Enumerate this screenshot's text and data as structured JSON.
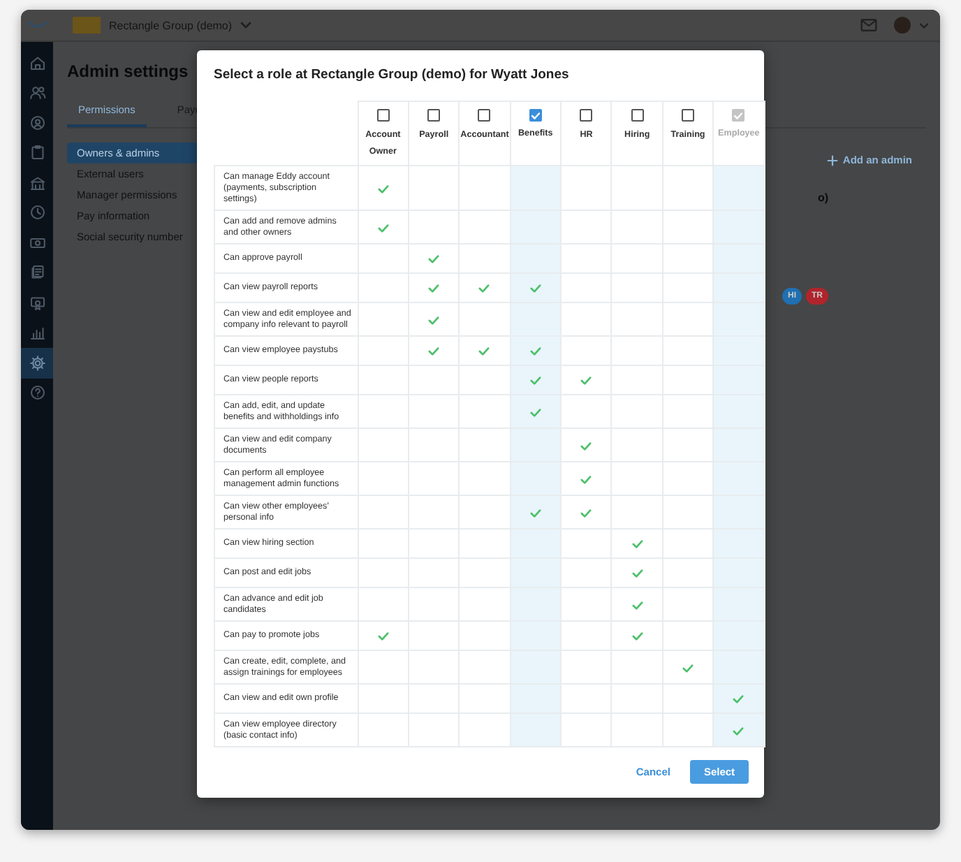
{
  "topbar": {
    "company": "Rectangle Group (demo)"
  },
  "sidebar": {
    "items": [
      {
        "kind": "home",
        "selected": false
      },
      {
        "kind": "people",
        "selected": false
      },
      {
        "kind": "person",
        "selected": false
      },
      {
        "kind": "clipboard",
        "selected": false
      },
      {
        "kind": "building",
        "selected": false
      },
      {
        "kind": "clock",
        "selected": false
      },
      {
        "kind": "money",
        "selected": false
      },
      {
        "kind": "documents",
        "selected": false
      },
      {
        "kind": "certificate",
        "selected": false
      },
      {
        "kind": "chart",
        "selected": false
      },
      {
        "kind": "gear",
        "selected": true
      },
      {
        "kind": "help",
        "selected": false
      }
    ]
  },
  "page": {
    "title": "Admin settings",
    "tabs": [
      {
        "label": "Permissions",
        "selected": true
      },
      {
        "label": "Payr",
        "selected": false
      }
    ],
    "nav": [
      {
        "label": "Owners & admins",
        "selected": true
      },
      {
        "label": "External users",
        "selected": false
      },
      {
        "label": "Manager permissions",
        "selected": false
      },
      {
        "label": "Pay information",
        "selected": false
      },
      {
        "label": "Social security number",
        "selected": false
      }
    ],
    "add_button": "Add an admin",
    "card_fragment": "o)",
    "badges": [
      {
        "label": "HI",
        "color": "#1f6fb2"
      },
      {
        "label": "TR",
        "color": "#b0242c"
      }
    ]
  },
  "dialog": {
    "title": "Select a role at Rectangle Group (demo) for Wyatt Jones",
    "columns": [
      {
        "label": "Account Owner",
        "checked": false,
        "disabled": false
      },
      {
        "label": "Payroll",
        "checked": false,
        "disabled": false
      },
      {
        "label": "Accountant",
        "checked": false,
        "disabled": false
      },
      {
        "label": "Benefits",
        "checked": true,
        "disabled": false
      },
      {
        "label": "HR",
        "checked": false,
        "disabled": false
      },
      {
        "label": "Hiring",
        "checked": false,
        "disabled": false
      },
      {
        "label": "Training",
        "checked": false,
        "disabled": false
      },
      {
        "label": "Employee",
        "checked": true,
        "disabled": true
      }
    ],
    "rows": [
      {
        "label": "Can manage Eddy account (payments, subscription settings)",
        "grants": [
          true,
          false,
          false,
          false,
          false,
          false,
          false,
          false
        ]
      },
      {
        "label": "Can add and remove admins and other owners",
        "grants": [
          true,
          false,
          false,
          false,
          false,
          false,
          false,
          false
        ]
      },
      {
        "label": "Can approve payroll",
        "grants": [
          false,
          true,
          false,
          false,
          false,
          false,
          false,
          false
        ]
      },
      {
        "label": "Can view payroll reports",
        "grants": [
          false,
          true,
          true,
          true,
          false,
          false,
          false,
          false
        ]
      },
      {
        "label": "Can view and edit employee and company info relevant to payroll",
        "grants": [
          false,
          true,
          false,
          false,
          false,
          false,
          false,
          false
        ]
      },
      {
        "label": "Can view employee paystubs",
        "grants": [
          false,
          true,
          true,
          true,
          false,
          false,
          false,
          false
        ]
      },
      {
        "label": "Can view people reports",
        "grants": [
          false,
          false,
          false,
          true,
          true,
          false,
          false,
          false
        ]
      },
      {
        "label": "Can add, edit, and update benefits and withholdings info",
        "grants": [
          false,
          false,
          false,
          true,
          false,
          false,
          false,
          false
        ]
      },
      {
        "label": "Can view and edit company documents",
        "grants": [
          false,
          false,
          false,
          false,
          true,
          false,
          false,
          false
        ]
      },
      {
        "label": "Can perform all employee management admin functions",
        "grants": [
          false,
          false,
          false,
          false,
          true,
          false,
          false,
          false
        ]
      },
      {
        "label": "Can view other employees' personal info",
        "grants": [
          false,
          false,
          false,
          true,
          true,
          false,
          false,
          false
        ]
      },
      {
        "label": "Can view hiring section",
        "grants": [
          false,
          false,
          false,
          false,
          false,
          true,
          false,
          false
        ]
      },
      {
        "label": "Can post and edit jobs",
        "grants": [
          false,
          false,
          false,
          false,
          false,
          true,
          false,
          false
        ]
      },
      {
        "label": "Can advance and edit job candidates",
        "grants": [
          false,
          false,
          false,
          false,
          false,
          true,
          false,
          false
        ]
      },
      {
        "label": "Can pay to promote jobs",
        "grants": [
          true,
          false,
          false,
          false,
          false,
          true,
          false,
          false
        ]
      },
      {
        "label": "Can create, edit, complete, and assign trainings for employees",
        "grants": [
          false,
          false,
          false,
          false,
          false,
          false,
          true,
          false
        ]
      },
      {
        "label": "Can view and edit own profile",
        "grants": [
          false,
          false,
          false,
          false,
          false,
          false,
          false,
          true
        ]
      },
      {
        "label": "Can view employee directory (basic contact info)",
        "grants": [
          false,
          false,
          false,
          false,
          false,
          false,
          false,
          true
        ]
      }
    ],
    "cancel": "Cancel",
    "confirm": "Select"
  }
}
